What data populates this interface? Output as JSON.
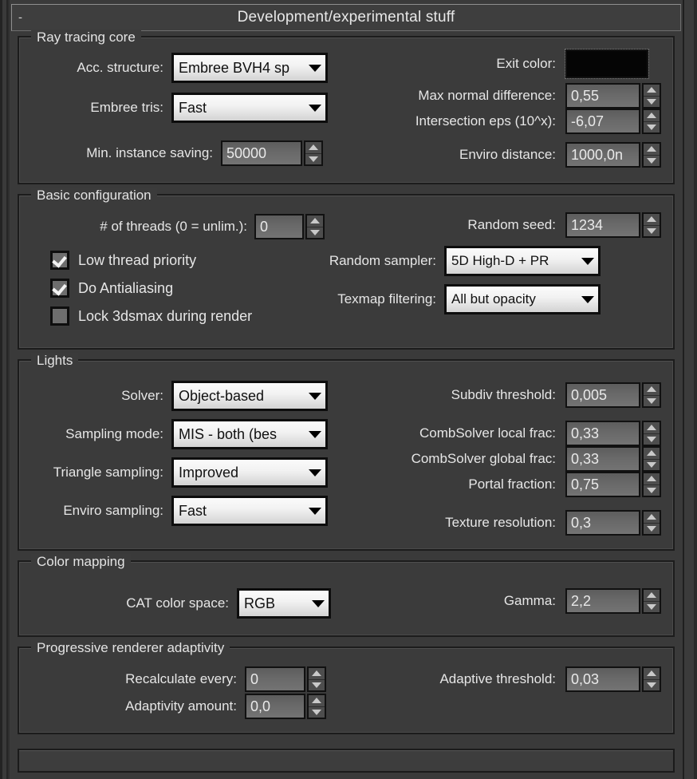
{
  "window": {
    "title": "Development/experimental stuff",
    "collapse_glyph": "-",
    "accent_dark": "#1c1c1c",
    "panel_bg": "#3b3b3b",
    "text_color": "#e6e6e6"
  },
  "groups": {
    "ray_tracing_core": {
      "legend": "Ray tracing core",
      "acc_structure": {
        "label": "Acc. structure:",
        "value": "Embree BVH4 sp"
      },
      "embree_tris": {
        "label": "Embree tris:",
        "value": "Fast"
      },
      "min_instance_saving": {
        "label": "Min. instance saving:",
        "value": "50000"
      },
      "exit_color": {
        "label": "Exit color:",
        "value": "#050505"
      },
      "max_normal_difference": {
        "label": "Max normal difference:",
        "value": "0,55"
      },
      "intersection_eps": {
        "label": "Intersection eps  (10^x):",
        "value": "-6,07"
      },
      "enviro_distance": {
        "label": "Enviro distance:",
        "value": "1000,0n"
      }
    },
    "basic_configuration": {
      "legend": "Basic configuration",
      "num_threads": {
        "label": "# of threads (0 = unlim.):",
        "value": "0"
      },
      "low_thread_priority": {
        "label": "Low thread priority",
        "checked": true
      },
      "do_antialiasing": {
        "label": "Do Antialiasing",
        "checked": true
      },
      "lock_3dsmax": {
        "label": "Lock 3dsmax during render",
        "checked": false
      },
      "random_seed": {
        "label": "Random seed:",
        "value": "1234"
      },
      "random_sampler": {
        "label": "Random sampler:",
        "value": "5D High-D  + PR"
      },
      "texmap_filtering": {
        "label": "Texmap filtering:",
        "value": "All but opacity"
      }
    },
    "lights": {
      "legend": "Lights",
      "solver": {
        "label": "Solver:",
        "value": "Object-based"
      },
      "sampling_mode": {
        "label": "Sampling mode:",
        "value": "MIS - both (bes"
      },
      "triangle_sampling": {
        "label": "Triangle sampling:",
        "value": "Improved"
      },
      "enviro_sampling": {
        "label": "Enviro sampling:",
        "value": "Fast"
      },
      "subdiv_threshold": {
        "label": "Subdiv threshold:",
        "value": "0,005"
      },
      "combsolver_local_frac": {
        "label": "CombSolver local frac:",
        "value": "0,33"
      },
      "combsolver_global_frac": {
        "label": "CombSolver global frac:",
        "value": "0,33"
      },
      "portal_fraction": {
        "label": "Portal fraction:",
        "value": "0,75"
      },
      "texture_resolution": {
        "label": "Texture resolution:",
        "value": "0,3"
      }
    },
    "color_mapping": {
      "legend": "Color mapping",
      "cat_color_space": {
        "label": "CAT color space:",
        "value": "RGB"
      },
      "gamma": {
        "label": "Gamma:",
        "value": "2,2"
      }
    },
    "progressive_renderer_adaptivity": {
      "legend": "Progressive renderer adaptivity",
      "recalculate_every": {
        "label": "Recalculate every:",
        "value": "0"
      },
      "adaptivity_amount": {
        "label": "Adaptivity amount:",
        "value": "0,0"
      },
      "adaptive_threshold": {
        "label": "Adaptive threshold:",
        "value": "0,03"
      }
    }
  }
}
